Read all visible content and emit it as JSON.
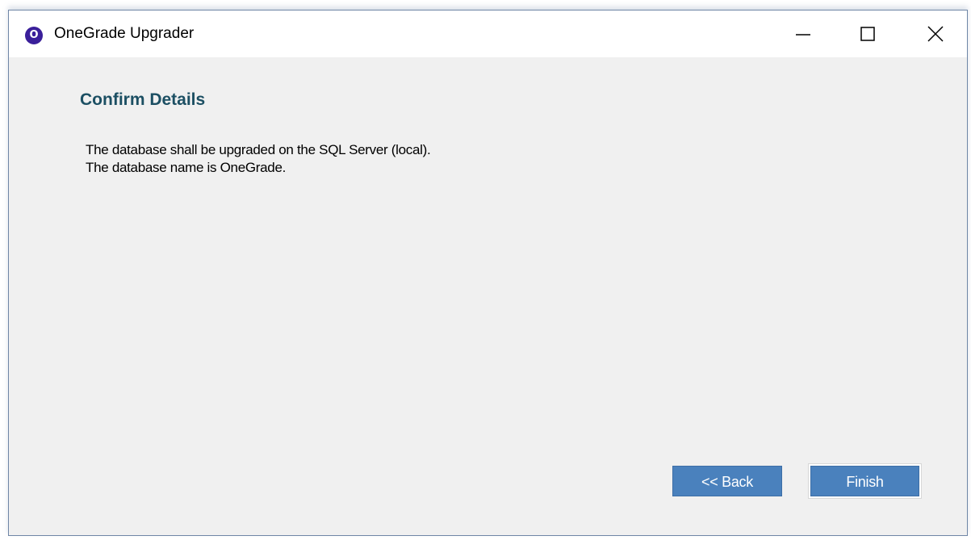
{
  "window": {
    "title": "OneGrade Upgrader",
    "icon_letter": "O",
    "icon": "onegrade-app-icon",
    "controls": {
      "minimize": "minimize-icon",
      "maximize": "maximize-icon",
      "close": "close-icon"
    }
  },
  "page": {
    "heading": "Confirm Details",
    "lines": [
      "The database shall be upgraded on the SQL Server (local).",
      "The database name is OneGrade."
    ]
  },
  "buttons": {
    "back_label": "<< Back",
    "finish_label": "Finish"
  },
  "colors": {
    "heading": "#1c4f63",
    "button_bg": "#4a81bd",
    "app_icon_bg": "#3a1f9a",
    "window_bg": "#f0f0f0"
  }
}
